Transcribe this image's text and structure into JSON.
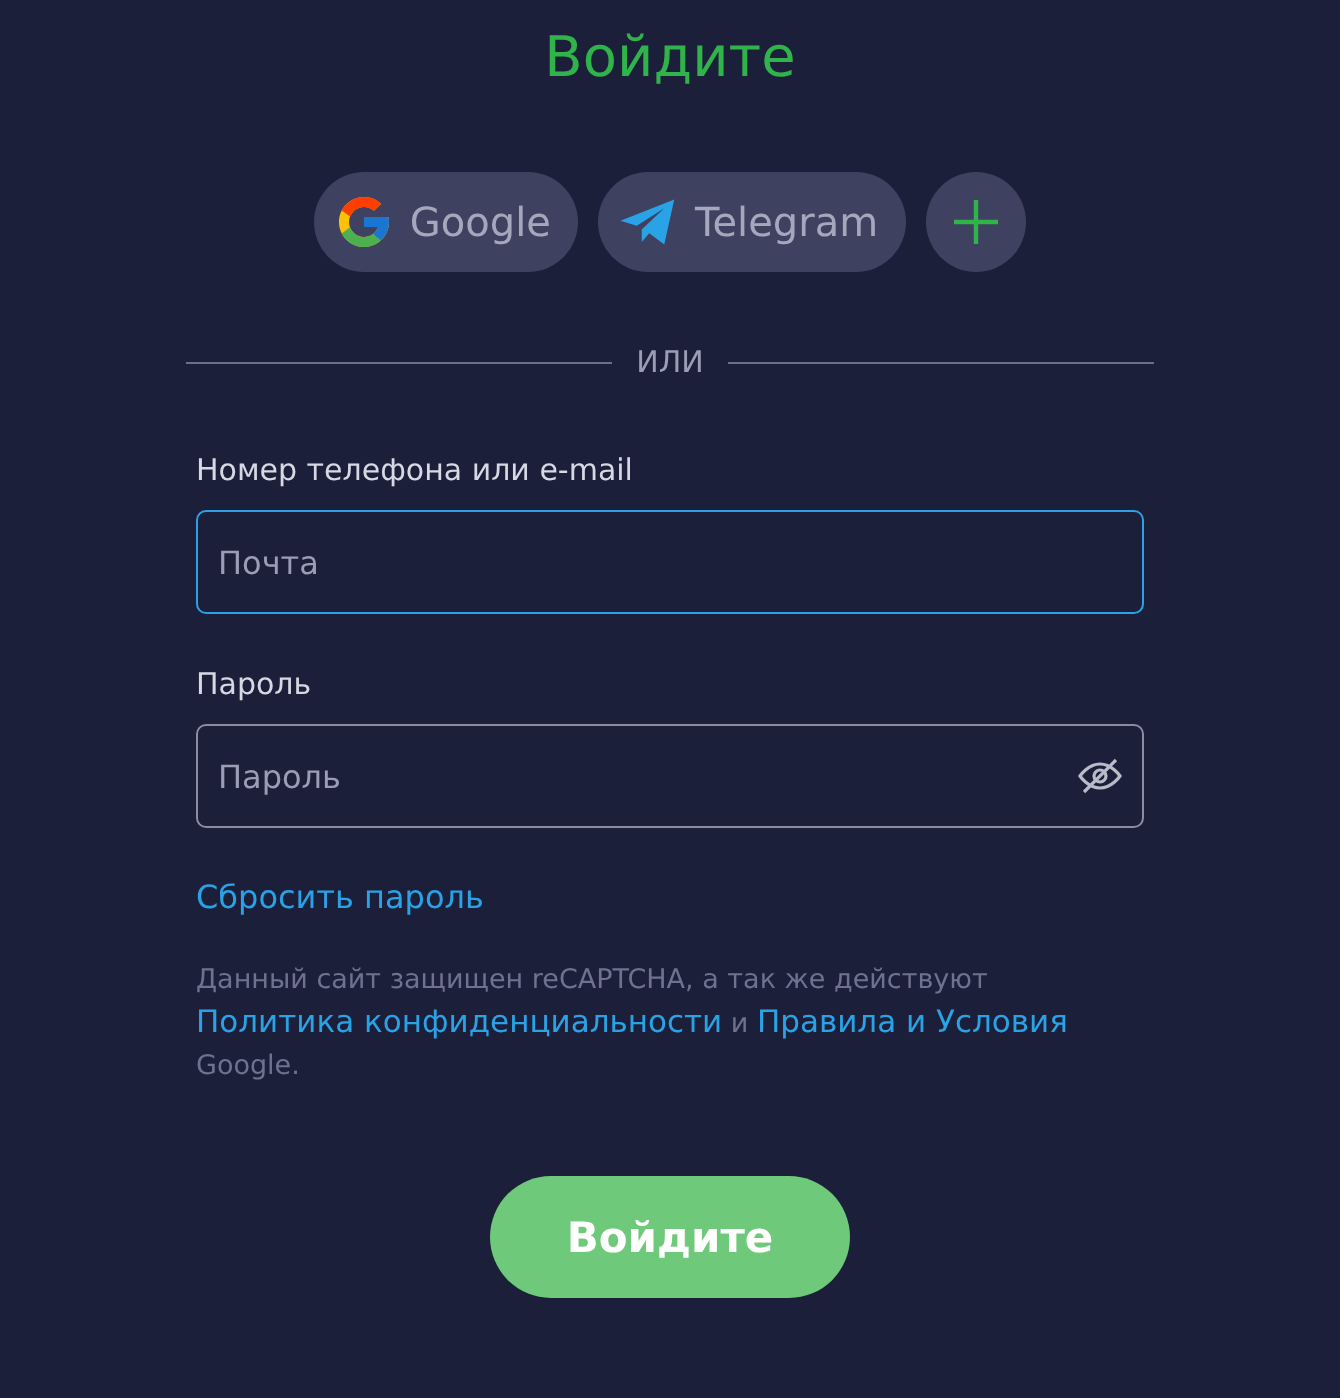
{
  "title": "Войдите",
  "social": [
    {
      "kind": "google",
      "label": "Google"
    },
    {
      "kind": "telegram",
      "label": "Telegram"
    },
    {
      "kind": "more"
    }
  ],
  "divider": "ИЛИ",
  "fields": [
    {
      "label": "Номер телефона или e-mail",
      "placeholder": "Почта",
      "focused": true,
      "kind": "text"
    },
    {
      "label": "Пароль",
      "placeholder": "Пароль",
      "focused": false,
      "kind": "password"
    }
  ],
  "reset_link": "Сбросить пароль",
  "consent": [
    {
      "kind": "text",
      "text": "Данный сайт защищен reCAPTCHA, а так же действуют"
    },
    {
      "kind": "link",
      "text": "Политика конфиденциальности"
    },
    {
      "kind": "text",
      "text": "и"
    },
    {
      "kind": "link",
      "text": "Правила и Условия"
    },
    {
      "kind": "text",
      "text": "Google."
    }
  ],
  "submit": "Войдите"
}
